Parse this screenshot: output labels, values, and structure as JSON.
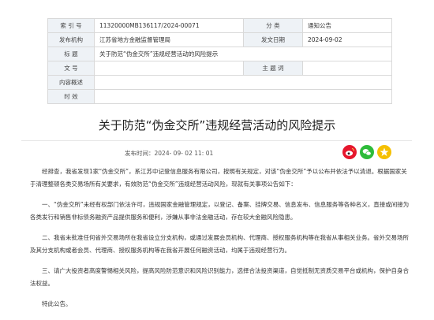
{
  "meta": {
    "index_label": "索 引 号",
    "index_value": "11320000MB136117/2024-00071",
    "category_label": "分 类",
    "category_value": "通知公告",
    "issuer_label": "发布机构",
    "issuer_value": "江苏省地方金融监督管理局",
    "date_label": "发文日期",
    "date_value": "2024-09-02",
    "title_label": "标 题",
    "title_value": "关于防范“伪金交所”违规经营活动的风险提示",
    "docno_label": "文 号",
    "docno_value": "",
    "keywords_label": "主 题 词",
    "keywords_value": "",
    "summary_label": "内容概述",
    "summary_value": "",
    "timeliness_label": "时 效",
    "timeliness_value": ""
  },
  "article": {
    "title": "关于防范“伪金交所”违规经营活动的风险提示",
    "publish_time": "发布时间：2024- 09- 02 11: 01",
    "paragraphs": [
      "经排查，我省发现1家“伪金交所”，系江苏中记登信息服务有限公司，按照有关规定，对该“伪金交所”予以公布并依法予以清退。根据国家关于清理整顿各类交易场所有关要求，有效防范“伪金交所”违规经营活动风险，现就有关事项公告如下：",
      "一、“伪金交所”未经有权部门依法许可，违规国家金融管理规定，以登记、备案、挂牌交易、信息发布、信息服务等各种名义，直接或间接为各类发行和销售非标债务融资产品提供服务和便利，涉嫌从事非法金融活动，存在较大金融风险隐患。",
      "二、我省未批准任何省外交易场所在我省设立分支机构，或通过发展会员机构、代理商、授权服务机构等在我省从事相关业务。省外交易场所及其分支机构或者会员、代理商、授权服务机构等在我省开展任何融资活动，均属于违规经营行为。",
      "三、请广大投资者高度警惕相关风险，提高风险防范意识和风险识别能力，选择合法投资渠道，自觉抵制无资质交易平台或机构，保护自身合法权益。",
      "特此公告。"
    ]
  },
  "share": {
    "weibo_color": "#e6162d",
    "wechat_color": "#2dbb3a",
    "qzone_color": "#f5c000"
  }
}
